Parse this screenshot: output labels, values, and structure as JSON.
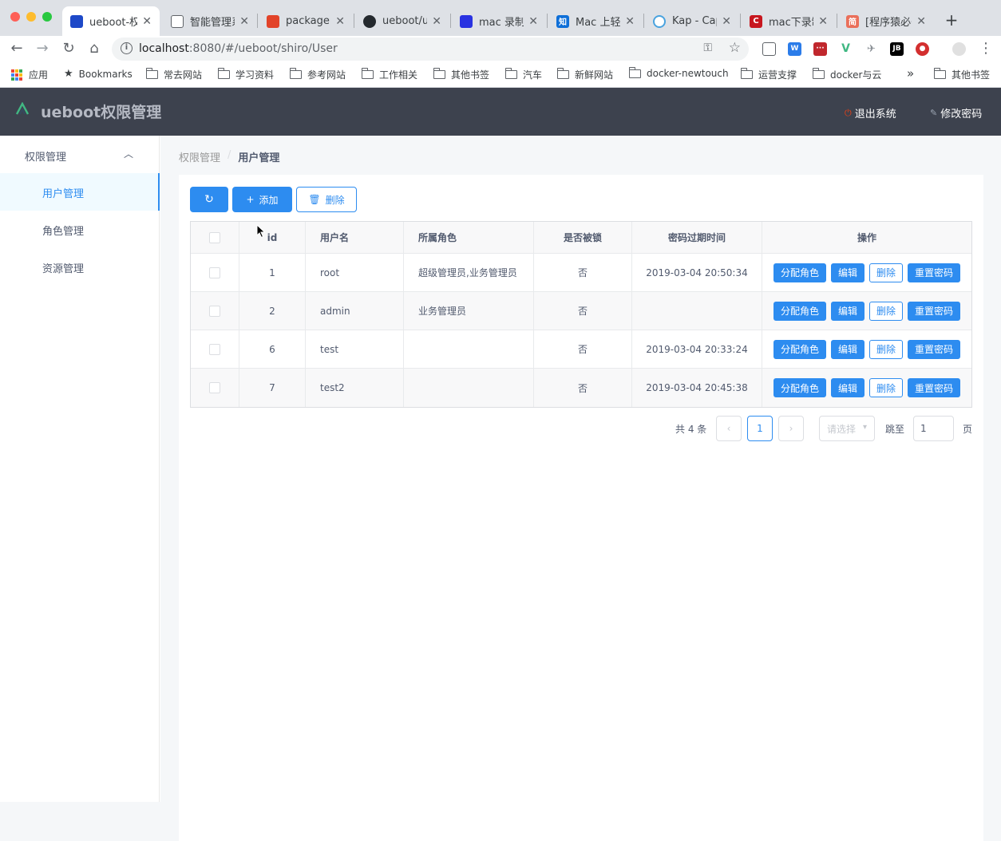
{
  "browser": {
    "tabs": [
      {
        "title": "ueboot-权",
        "active": true,
        "favicon_color": "#1e49c8"
      },
      {
        "title": "智能管理系",
        "active": false,
        "favicon_color": "#5f6368"
      },
      {
        "title": "package.js",
        "active": false,
        "favicon_color": "#e24329"
      },
      {
        "title": "ueboot/ue",
        "active": false,
        "favicon_color": "#24292e"
      },
      {
        "title": "mac 录制g",
        "active": false,
        "favicon_color": "#2932e1"
      },
      {
        "title": "Mac 上轻松",
        "active": false,
        "favicon_color": "#0e6fd8"
      },
      {
        "title": "Kap - Cap",
        "active": false,
        "favicon_color": "#4aa3df"
      },
      {
        "title": "mac下录制",
        "active": false,
        "favicon_color": "#c7161e"
      },
      {
        "title": "[程序猿必备",
        "active": false,
        "favicon_color": "#ea6f5a"
      }
    ],
    "favicon_glyphs": [
      "",
      "",
      "",
      "",
      "",
      "知",
      "",
      "C",
      "简"
    ],
    "url": {
      "host": "localhost",
      "path": ":8080/#/ueboot/shiro/User"
    },
    "bookmarks": {
      "apps": "应用",
      "bookmarks": "Bookmarks",
      "folders": [
        "常去网站",
        "学习资料",
        "参考网站",
        "工作相关",
        "其他书签",
        "汽车",
        "新鲜网站",
        "docker-newtouch",
        "运营支撑",
        "docker与云"
      ],
      "more": "»",
      "other": "其他书签"
    }
  },
  "app": {
    "title": "ueboot权限管理",
    "logout": "退出系统",
    "change_password": "修改密码"
  },
  "sidebar": {
    "group": "权限管理",
    "items": [
      {
        "label": "用户管理",
        "active": true
      },
      {
        "label": "角色管理",
        "active": false
      },
      {
        "label": "资源管理",
        "active": false
      }
    ]
  },
  "breadcrumb": {
    "parent": "权限管理",
    "current": "用户管理"
  },
  "toolbar": {
    "add": "添加",
    "delete": "删除"
  },
  "table": {
    "columns": [
      "id",
      "用户名",
      "所属角色",
      "是否被锁",
      "密码过期时间",
      "操作"
    ],
    "rows": [
      {
        "id": "1",
        "username": "root",
        "roles": "超级管理员,业务管理员",
        "locked": "否",
        "expire": "2019-03-04 20:50:34"
      },
      {
        "id": "2",
        "username": "admin",
        "roles": "业务管理员",
        "locked": "否",
        "expire": ""
      },
      {
        "id": "6",
        "username": "test",
        "roles": "",
        "locked": "否",
        "expire": "2019-03-04 20:33:24"
      },
      {
        "id": "7",
        "username": "test2",
        "roles": "",
        "locked": "否",
        "expire": "2019-03-04 20:45:38"
      }
    ],
    "actions": {
      "assign": "分配角色",
      "edit": "编辑",
      "delete": "删除",
      "reset": "重置密码"
    }
  },
  "pagination": {
    "total": "共 4 条",
    "current_page": "1",
    "page_size_placeholder": "请选择",
    "jump_label": "跳至",
    "jump_value": "1",
    "page_suffix": "页"
  },
  "colors": {
    "primary": "#2d8cf0",
    "header": "#3d424e"
  }
}
